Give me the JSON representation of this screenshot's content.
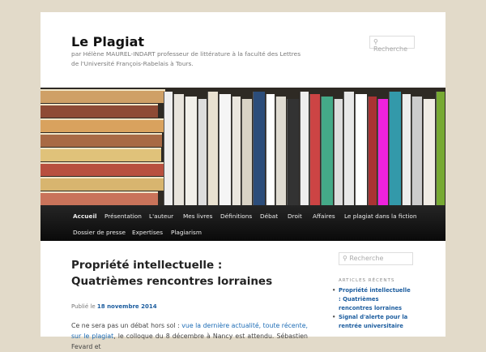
{
  "site": {
    "title": "Le Plagiat",
    "description": "par Hélène MAUREL-INDART professeur de littérature à la faculté des Lettres de l'Université François-Rabelais à Tours.",
    "search_placeholder": "Recherche"
  },
  "nav": {
    "items": [
      "Accueil",
      "Présentation",
      "L'auteur",
      "Mes livres",
      "Définitions",
      "Débat",
      "Droit",
      "Affaires",
      "Le plagiat dans la fiction",
      "Dossier de presse",
      "Expertises",
      "Plagiarism"
    ]
  },
  "post": {
    "title": "Propriété intellectuelle : Quatrièmes rencontres lorraines",
    "meta_prefix": "Publié le",
    "date": "18 novembre 2014",
    "text_start": "Ce ne sera pas un débat hors sol : ",
    "link_text": "vue la dernière actualité, toute récente, sur le plagiat",
    "text_end": ", le colloque du 8 décembre à Nancy est attendu. Sébastien Fevard et"
  },
  "sidebar": {
    "search_placeholder": "Recherche",
    "recent_title": "ARTICLES RÉCENTS",
    "recent": [
      "Propriété intellectuelle : Quatrièmes rencontres lorraines",
      "Signal d'alerte pour la rentrée universitaire"
    ]
  },
  "colors": {
    "link": "#1b6bb5",
    "nav_bg": "#111111",
    "page_bg": "#e2dac9"
  }
}
